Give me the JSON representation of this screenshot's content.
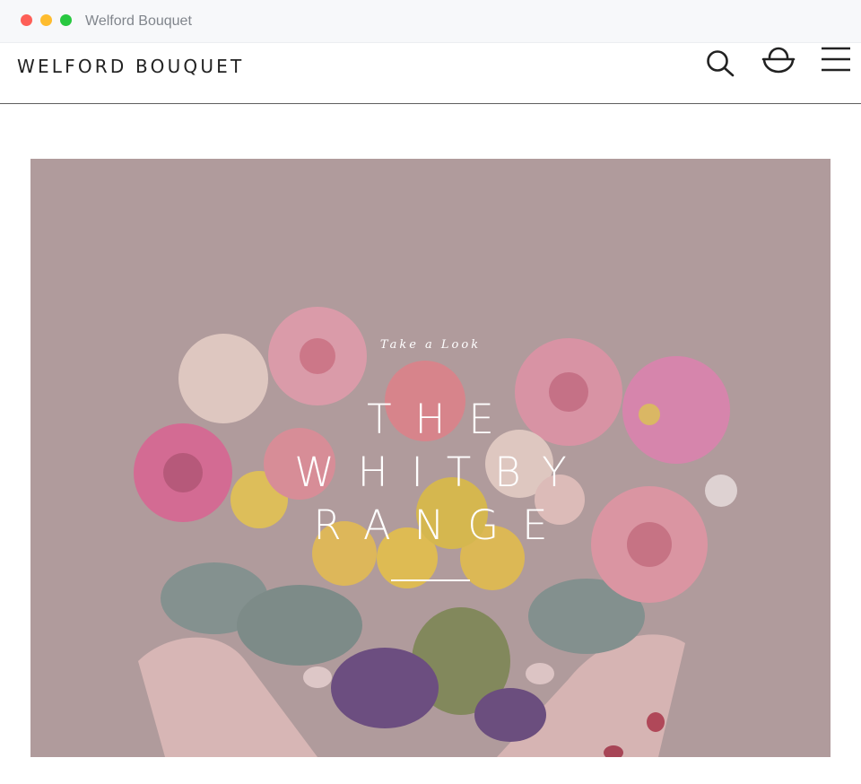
{
  "window": {
    "title": "Welford Bouquet",
    "controls": [
      "close",
      "minimize",
      "maximize"
    ]
  },
  "header": {
    "logo": "WELFORD BOUQUET",
    "icons": [
      "search-icon",
      "basket-icon",
      "menu-icon"
    ]
  },
  "hero": {
    "eyebrow": "Take a Look",
    "headline_lines": [
      "THE",
      "WHITBY",
      "RANGE"
    ],
    "overlay_color": "#b09b9d"
  },
  "colors": {
    "text_dark": "#222222",
    "header_rule": "#5f5f5f",
    "close_dot": "#fe5f57",
    "minimize_dot": "#febc2e",
    "maximize_dot": "#28c840"
  }
}
